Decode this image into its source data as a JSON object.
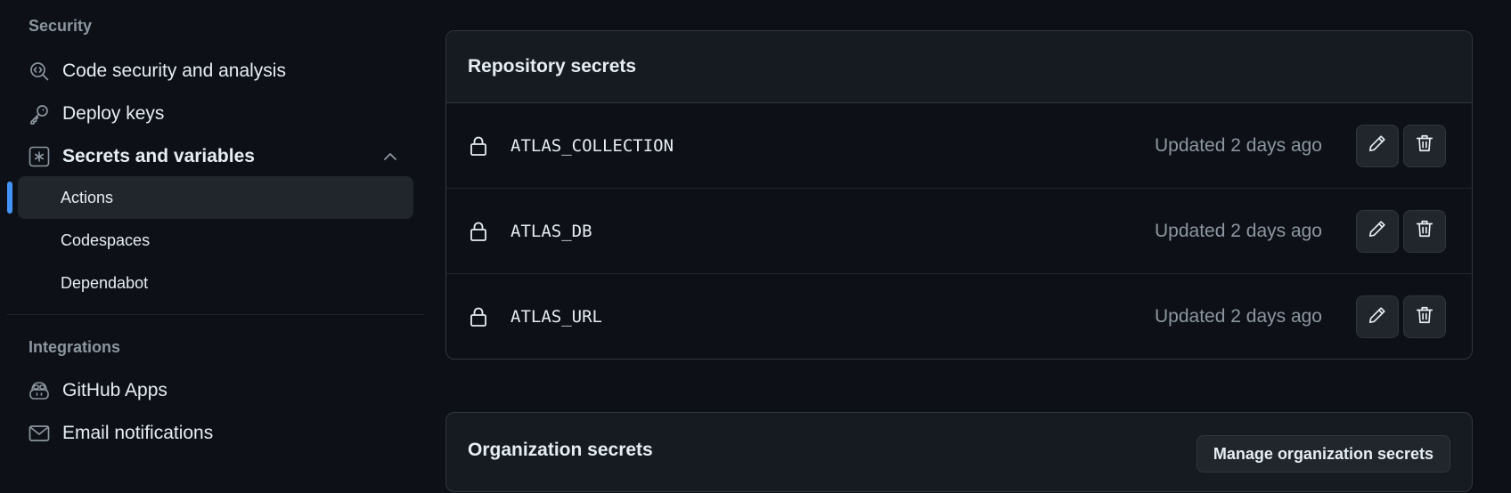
{
  "sidebar": {
    "security_heading": "Security",
    "security_items": [
      {
        "label": "Code security and analysis",
        "icon": "codescan-icon"
      },
      {
        "label": "Deploy keys",
        "icon": "key-icon"
      },
      {
        "label": "Secrets and variables",
        "icon": "asterisk-icon",
        "expanded": true
      }
    ],
    "sub_items": [
      {
        "label": "Actions",
        "active": true
      },
      {
        "label": "Codespaces",
        "active": false
      },
      {
        "label": "Dependabot",
        "active": false
      }
    ],
    "integrations_heading": "Integrations",
    "integration_items": [
      {
        "label": "GitHub Apps",
        "icon": "copilot-icon"
      },
      {
        "label": "Email notifications",
        "icon": "mail-icon"
      }
    ]
  },
  "repo_secrets": {
    "title": "Repository secrets",
    "rows": [
      {
        "name": "ATLAS_COLLECTION",
        "updated": "Updated 2 days ago"
      },
      {
        "name": "ATLAS_DB",
        "updated": "Updated 2 days ago"
      },
      {
        "name": "ATLAS_URL",
        "updated": "Updated 2 days ago"
      }
    ]
  },
  "org_secrets": {
    "title": "Organization secrets",
    "manage_label": "Manage organization secrets"
  },
  "colors": {
    "background": "#0d1117",
    "panel_header": "#161b22",
    "border": "#30363d",
    "accent": "#4493f8",
    "muted_text": "#8d96a0"
  }
}
